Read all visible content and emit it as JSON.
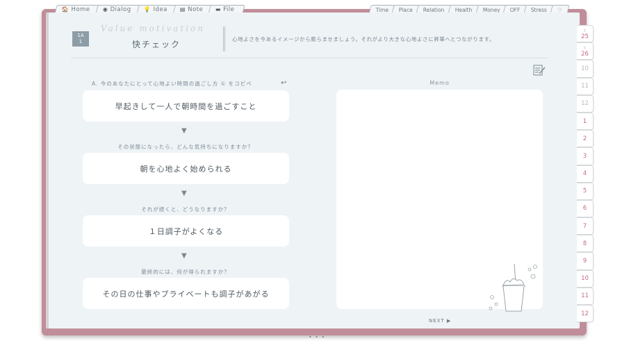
{
  "top_tabs": [
    {
      "icon": "🏠",
      "label": "Home"
    },
    {
      "icon": "◉",
      "label": "Dialog"
    },
    {
      "icon": "💡",
      "label": "Idea"
    },
    {
      "icon": "▤",
      "label": "Note"
    },
    {
      "icon": "▬",
      "label": "File"
    }
  ],
  "right_tabs": [
    "Time",
    "Place",
    "Relation",
    "Health",
    "Money",
    "OFF",
    "Stress",
    "♡"
  ],
  "side_tabs": [
    {
      "label": "25",
      "year": "Y"
    },
    {
      "label": "26",
      "year": "Y"
    },
    {
      "label": "10"
    },
    {
      "label": "11"
    },
    {
      "label": "12"
    },
    {
      "label": "1"
    },
    {
      "label": "2"
    },
    {
      "label": "3"
    },
    {
      "label": "4"
    },
    {
      "label": "5"
    },
    {
      "label": "6"
    },
    {
      "label": "7"
    },
    {
      "label": "8"
    },
    {
      "label": "9"
    },
    {
      "label": "10"
    },
    {
      "label": "11"
    },
    {
      "label": "12"
    }
  ],
  "header": {
    "month_top": "1A",
    "month_bottom": "1",
    "script_title": "Value motivation",
    "title": "快チェック",
    "description": "心地よさを今あるイメージから膨らませましょう。それがより大きな心地よさに昇華へとつながります。"
  },
  "questions": [
    "A. 今のあなたにとって心地よい時間の過ごし方 ① をコピペ",
    "その状態になったら、どんな気持ちになりますか？",
    "それが続くと、どうなりますか？",
    "最終的には、何が得られますか？"
  ],
  "answers": [
    "早起きして一人で朝時間を過ごすこと",
    "朝を心地よく始められる",
    "１日調子がよくなる",
    "その日の仕事やプライベートも調子があがる"
  ],
  "arrow": "▼",
  "undo_icon": "↩",
  "memo": {
    "label": "Memo"
  },
  "next_label": "NEXT ▶",
  "bottom_dots": "• • •",
  "colors": {
    "cover": "#c08d9a",
    "page": "#eef3f6",
    "accent_red": "#c56c7e",
    "month_box": "#8d9da8"
  }
}
